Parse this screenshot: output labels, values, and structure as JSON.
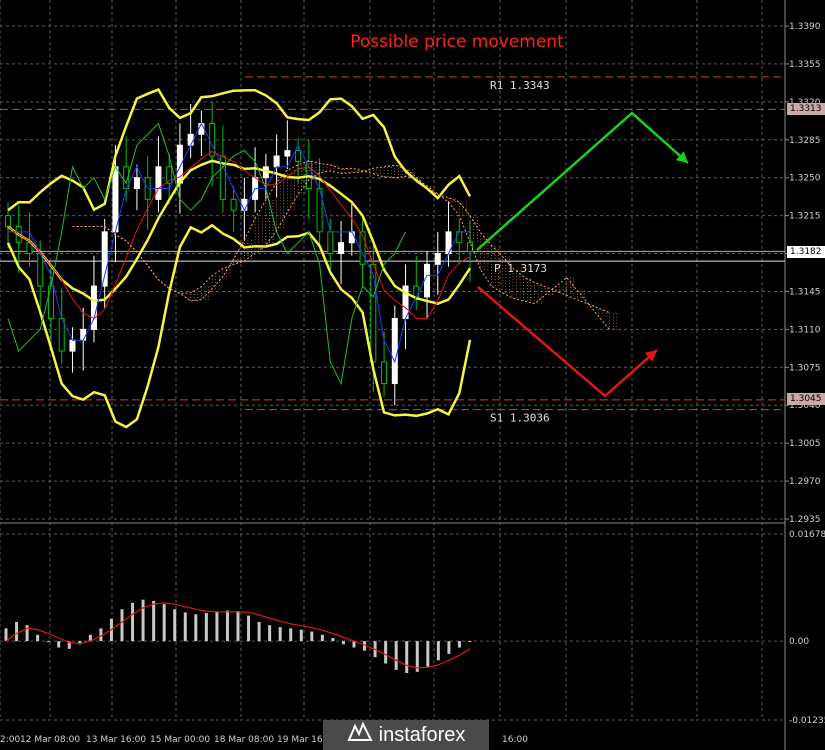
{
  "chart_title": "Possible price movement",
  "colors": {
    "background": "#000000",
    "grid": "#5a5a5a",
    "candle_up": "#ffffff",
    "candle_down": "#00c000",
    "bollinger": "#f5f542",
    "tenkan": "#1a3cff",
    "kijun": "#e01515",
    "chikou": "#22c022",
    "kumo": "#f4a460",
    "pivot_line": "#c8423c",
    "arrow_up": "#19d219",
    "arrow_down": "#e01515",
    "macd_hist": "#c8c8c8",
    "macd_signal": "#e01515",
    "axis_text": "#d0d0d0"
  },
  "levels": {
    "r1": {
      "label": "R1",
      "value": "1.3343"
    },
    "pivot": {
      "label": "P",
      "value": "1.3173"
    },
    "s1": {
      "label": "S1",
      "value": "1.3036"
    }
  },
  "price_tags": {
    "upper": "1.3313",
    "current": "1.3182",
    "lower": "1.3045"
  },
  "chart_data": [
    {
      "type": "candlestick",
      "y_axis_ticks": [
        "1.3390",
        "1.3355",
        "1.3320",
        "1.3285",
        "1.3250",
        "1.3215",
        "1.3180",
        "1.3145",
        "1.3110",
        "1.3075",
        "1.3040",
        "1.3005",
        "1.2970",
        "1.2935"
      ],
      "ylim": [
        1.2935,
        1.339
      ],
      "x_tick_labels": [
        "2:00",
        "12 Mar 08:00",
        "13 Mar 16:00",
        "15 Mar 00:00",
        "18 Mar 08:00",
        "19 Mar 16:00",
        "",
        "",
        "16:00"
      ],
      "close_series": [
        1.3205,
        1.319,
        1.318,
        1.315,
        1.312,
        1.309,
        1.31,
        1.311,
        1.315,
        1.32,
        1.326,
        1.324,
        1.325,
        1.323,
        1.326,
        1.3245,
        1.328,
        1.329,
        1.33,
        1.327,
        1.323,
        1.322,
        1.323,
        1.325,
        1.326,
        1.327,
        1.3275,
        1.3265,
        1.324,
        1.32,
        1.318,
        1.319,
        1.32,
        1.317,
        1.308,
        1.306,
        1.312,
        1.315,
        1.314,
        1.317,
        1.318,
        1.32,
        1.319,
        1.3182
      ],
      "annotations": [
        "R1 1.3343",
        "P 1.3173",
        "S1 1.3036"
      ]
    },
    {
      "type": "bar",
      "name": "MACD",
      "y_axis_ticks": [
        "0.01678",
        "0.00",
        "-0.01235"
      ],
      "ylim": [
        -0.01235,
        0.01678
      ],
      "values": [
        0.002,
        0.003,
        0.0025,
        0.001,
        0.0,
        -0.001,
        -0.0012,
        -0.0005,
        0.001,
        0.002,
        0.0035,
        0.005,
        0.006,
        0.0065,
        0.0063,
        0.0058,
        0.005,
        0.0045,
        0.0042,
        0.0044,
        0.0046,
        0.0048,
        0.0047,
        0.004,
        0.003,
        0.0025,
        0.0022,
        0.002,
        0.0018,
        0.0015,
        0.001,
        0.0005,
        -0.0005,
        -0.001,
        -0.0015,
        -0.0025,
        -0.0035,
        -0.0045,
        -0.005,
        -0.0048,
        -0.004,
        -0.003,
        -0.002,
        -0.001,
        0.0
      ],
      "signal": [
        0.0,
        0.0012,
        0.002,
        0.0018,
        0.0012,
        0.0005,
        -0.0002,
        -0.0004,
        0.0,
        0.0008,
        0.0018,
        0.003,
        0.0042,
        0.0052,
        0.0058,
        0.006,
        0.0058,
        0.0054,
        0.005,
        0.0047,
        0.0046,
        0.0046,
        0.0046,
        0.0045,
        0.0041,
        0.0036,
        0.0031,
        0.0027,
        0.0024,
        0.0021,
        0.0017,
        0.0012,
        0.0006,
        0.0,
        -0.0006,
        -0.0013,
        -0.0021,
        -0.003,
        -0.0038,
        -0.0042,
        -0.0041,
        -0.0037,
        -0.003,
        -0.0022,
        -0.0012
      ]
    }
  ],
  "logo": {
    "text": "instaforex"
  }
}
